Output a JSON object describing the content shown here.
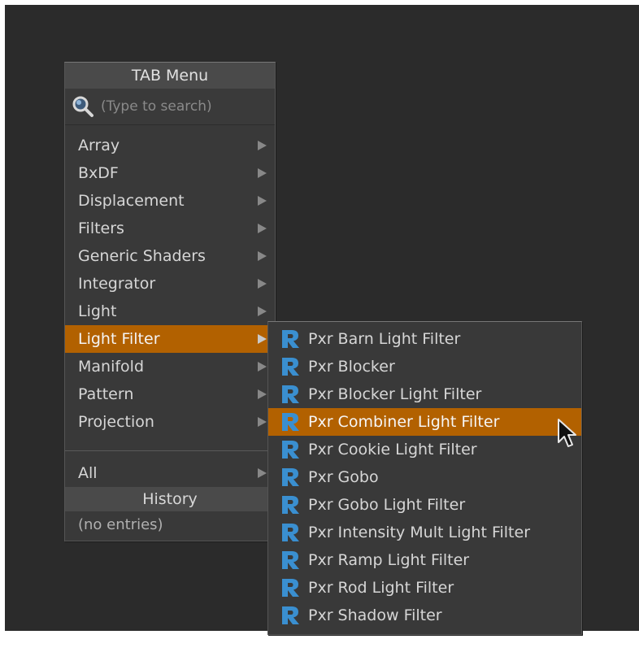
{
  "tab_menu": {
    "title": "TAB Menu",
    "search_placeholder": "(Type to search)",
    "items": [
      {
        "label": "Array"
      },
      {
        "label": "BxDF"
      },
      {
        "label": "Displacement"
      },
      {
        "label": "Filters"
      },
      {
        "label": "Generic Shaders"
      },
      {
        "label": "Integrator"
      },
      {
        "label": "Light"
      },
      {
        "label": "Light Filter"
      },
      {
        "label": "Manifold"
      },
      {
        "label": "Pattern"
      },
      {
        "label": "Projection"
      }
    ],
    "all_label": "All",
    "history_title": "History",
    "history_empty": "(no entries)",
    "active_item": "Light Filter"
  },
  "submenu": {
    "items": [
      {
        "label": "Pxr Barn Light Filter"
      },
      {
        "label": "Pxr Blocker"
      },
      {
        "label": "Pxr Blocker Light Filter"
      },
      {
        "label": "Pxr Combiner Light Filter"
      },
      {
        "label": "Pxr Cookie Light Filter"
      },
      {
        "label": "Pxr Gobo"
      },
      {
        "label": "Pxr Gobo Light Filter"
      },
      {
        "label": "Pxr Intensity Mult Light Filter"
      },
      {
        "label": "Pxr Ramp Light Filter"
      },
      {
        "label": "Pxr Rod Light Filter"
      },
      {
        "label": "Pxr Shadow Filter"
      }
    ],
    "active_item": "Pxr Combiner Light Filter",
    "item_icon": "renderman-r-icon"
  },
  "colors": {
    "highlight": "#b26100",
    "menu_bg": "#393939",
    "header_bg": "#4a4a4a",
    "canvas_bg": "#2b2b2b",
    "r_icon_blue": "#3a8fd0"
  }
}
